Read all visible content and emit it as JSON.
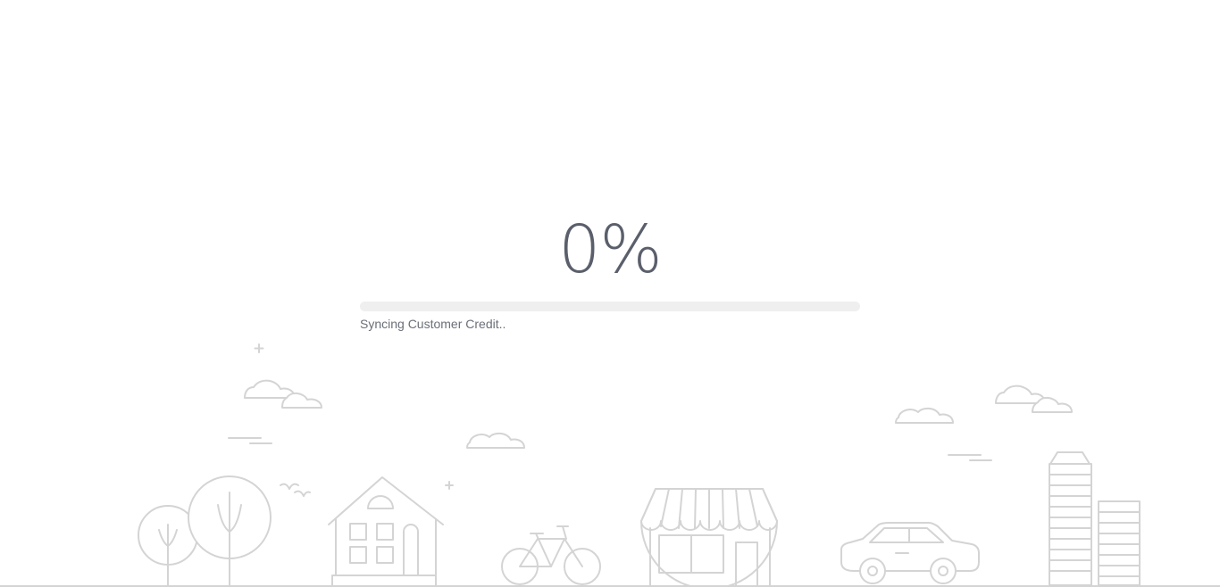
{
  "progress": {
    "percent_label": "0%",
    "value": 0,
    "status": "Syncing Customer Credit.."
  },
  "colors": {
    "text": "#5a5f6b",
    "track": "#efefef",
    "illustration": "#d4d4d4"
  },
  "illustration": {
    "icons": [
      "tree-icon",
      "house-icon",
      "bicycle-icon",
      "shop-icon",
      "car-icon",
      "building-icon",
      "cloud-icon",
      "birds-icon"
    ]
  }
}
